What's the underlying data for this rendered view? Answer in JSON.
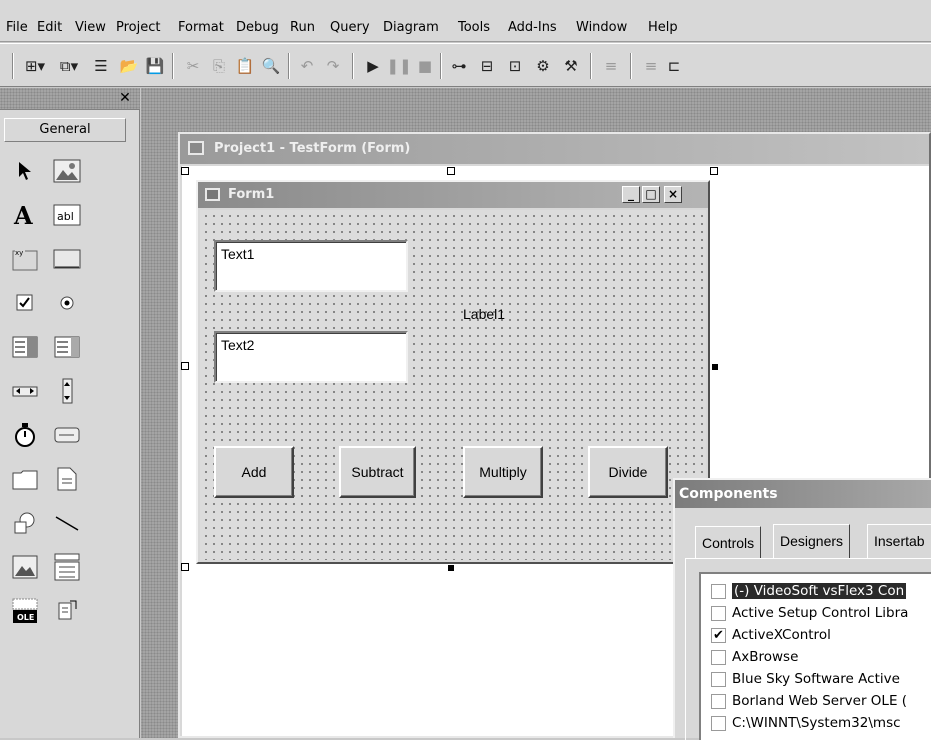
{
  "menu": [
    "File",
    "Edit",
    "View",
    "Project",
    "Format",
    "Debug",
    "Run",
    "Query",
    "Diagram",
    "Tools",
    "Add-Ins",
    "Window",
    "Help"
  ],
  "toolbox": {
    "close_glyph": "✕",
    "tab_label": "General"
  },
  "project_window": {
    "title": "Project1 - TestForm (Form)"
  },
  "form": {
    "title": "Form1",
    "minimize": "_",
    "maximize": "□",
    "close": "×",
    "text1": "Text1",
    "text2": "Text2",
    "label1": "Label1",
    "buttons": {
      "add": "Add",
      "subtract": "Subtract",
      "multiply": "Multiply",
      "divide": "Divide"
    }
  },
  "components": {
    "title": "Components",
    "tabs": [
      "Controls",
      "Designers",
      "Insertab"
    ],
    "items": [
      {
        "label": "(-) VideoSoft vsFlex3 Con",
        "checked": false,
        "selected": true
      },
      {
        "label": "Active Setup Control Libra",
        "checked": false,
        "selected": false
      },
      {
        "label": "ActiveXControl",
        "checked": true,
        "selected": false
      },
      {
        "label": "AxBrowse",
        "checked": false,
        "selected": false
      },
      {
        "label": "Blue Sky Software Active",
        "checked": false,
        "selected": false
      },
      {
        "label": "Borland Web Server OLE (",
        "checked": false,
        "selected": false
      },
      {
        "label": "C:\\WINNT\\System32\\msc",
        "checked": false,
        "selected": false
      }
    ]
  },
  "colors": {
    "titlebar": "#9a9a9a",
    "face": "#d8d8d8",
    "workspace": "#a4a4a4"
  }
}
